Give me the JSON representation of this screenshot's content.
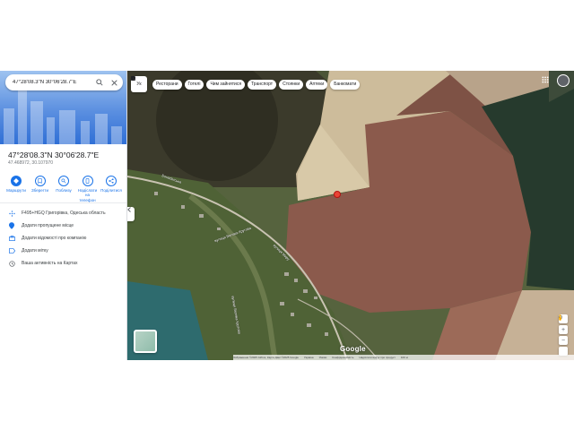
{
  "search": {
    "value": "47°28'08.3\"N 30°06'28.7\"E"
  },
  "place": {
    "coords_dms": "47°28'08.3\"N 30°06'28.7\"E",
    "coords_decimal": "47.468972, 30.107970"
  },
  "actions": [
    {
      "label": "Маршрути",
      "icon": "directions-icon"
    },
    {
      "label": "Зберегти",
      "icon": "bookmark-icon"
    },
    {
      "label": "Поблизу",
      "icon": "nearby-icon"
    },
    {
      "label": "Надіслати на телефон",
      "icon": "send-to-phone-icon"
    },
    {
      "label": "Поділитися",
      "icon": "share-icon"
    }
  ],
  "details": [
    {
      "text": "F495+HGQ Григорівка, Одеська область",
      "icon": "plus-code-icon"
    },
    {
      "text": "Додати пропущене місце",
      "icon": "add-place-icon"
    },
    {
      "text": "Додати відомості про компанію",
      "icon": "business-icon"
    },
    {
      "text": "Додати мітку",
      "icon": "label-icon"
    },
    {
      "text": "Ваша активність на Картах",
      "icon": "history-icon"
    }
  ],
  "map": {
    "layer_label": "Ук",
    "chips": [
      {
        "label": "Ресторани",
        "icon": "fork-knife-icon"
      },
      {
        "label": "Готелі",
        "icon": "bed-icon"
      },
      {
        "label": "Чим зайнятися",
        "icon": "camera-icon"
      },
      {
        "label": "Транспорт",
        "icon": "bus-icon"
      },
      {
        "label": "Стоянки",
        "icon": "parking-icon"
      },
      {
        "label": "Аптеки",
        "icon": "pharmacy-icon"
      },
      {
        "label": "Банкомати",
        "icon": "atm-icon"
      }
    ],
    "labels": {
      "road1": "Бонабінська",
      "road2": "вулиця Велика Кругова",
      "road3": "вулиця Миру",
      "road4": "вулиця Велика Кругова"
    },
    "logo": "Google",
    "footer": [
      "Зображення ©2025 Airbus, Карта Дані ©2025 Google",
      "Україна",
      "Умови",
      "Конфіденційність",
      "Надіслати відгук про продукт",
      "100 м"
    ],
    "colors": {
      "pin": "#ea4335",
      "accent": "#1a73e8"
    }
  }
}
